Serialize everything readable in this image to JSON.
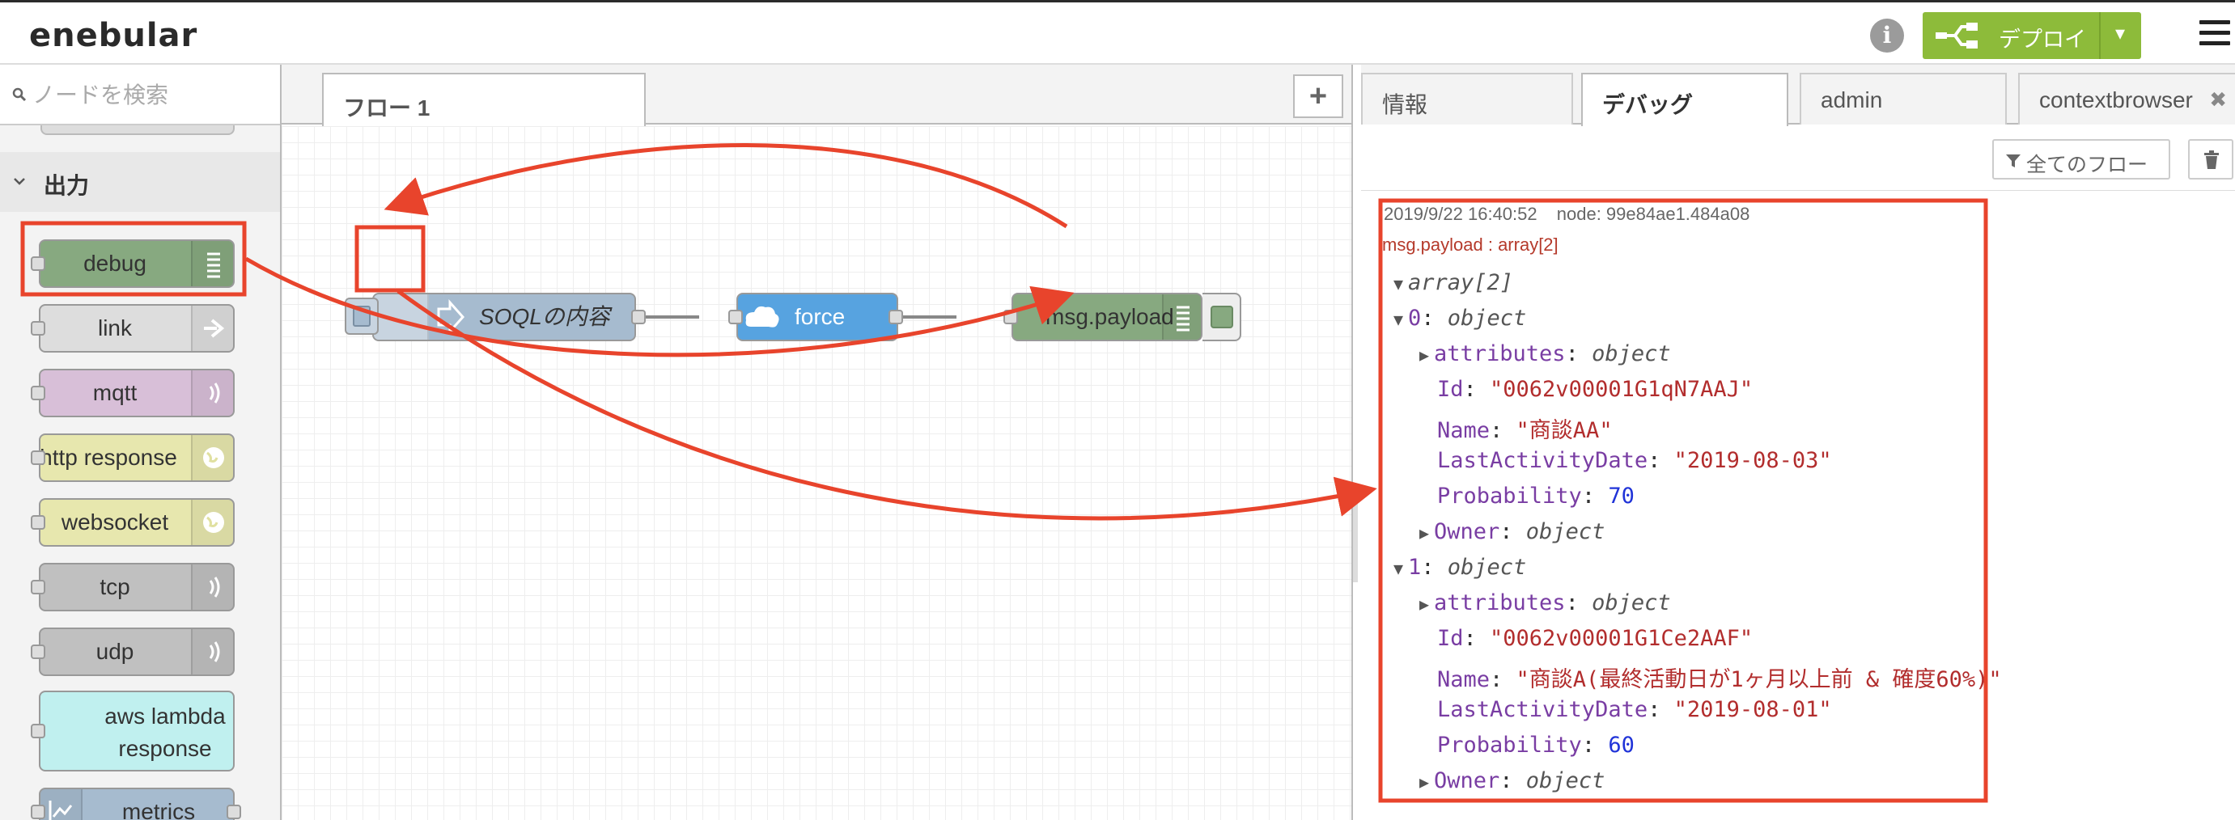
{
  "app": {
    "logo": "enebular"
  },
  "header": {
    "deploy_label": "デプロイ",
    "deploy_caret": "▾"
  },
  "palette": {
    "search_placeholder": "ノードを検索",
    "category": "出力",
    "nodes": [
      {
        "label": "debug",
        "color": "#87a980"
      },
      {
        "label": "link",
        "color": "#dddddd"
      },
      {
        "label": "mqtt",
        "color": "#d8bfd8"
      },
      {
        "label": "http response",
        "color": "#e7e7ae"
      },
      {
        "label": "websocket",
        "color": "#e7e7ae"
      },
      {
        "label": "tcp",
        "color": "#c0c0c0"
      },
      {
        "label": "udp",
        "color": "#c0c0c0"
      },
      {
        "label_line1": "aws lambda",
        "label_line2": "response",
        "color": "#c0f0ef"
      },
      {
        "label": "metrics",
        "color": "#a6bbcf"
      }
    ]
  },
  "workspace": {
    "tab_label": "フロー 1",
    "add_tab": "+",
    "flow_nodes": [
      {
        "label": "SOQLの内容",
        "type": "inject",
        "color": "#a6bbcf"
      },
      {
        "label": "force",
        "type": "salesforce",
        "color": "#57a3e0"
      },
      {
        "label": "msg.payload",
        "type": "debug",
        "color": "#87a980"
      }
    ]
  },
  "sidebar": {
    "tabs": [
      {
        "label": "情報"
      },
      {
        "label": "デバッグ"
      },
      {
        "label": "admin"
      },
      {
        "label": "contextbrowser"
      }
    ],
    "filter_label": "全てのフロー",
    "debug": {
      "timestamp": "2019/9/22 16:40:52",
      "node": "node: 99e84ae1.484a08",
      "topic": "msg.payload : array[2]",
      "tree": {
        "root": "array[2]",
        "item0_key": "0",
        "item1_key": "1",
        "object": "object",
        "attributes_key": "attributes",
        "owner_key": "Owner",
        "id_key": "Id",
        "name_key": "Name",
        "lad_key": "LastActivityDate",
        "prob_key": "Probability",
        "item0": {
          "id": "\"0062v00001G1qN7AAJ\"",
          "name": "\"商談AA\"",
          "lad": "\"2019-08-03\"",
          "prob": "70"
        },
        "item1": {
          "id": "\"0062v00001G1Ce2AAF\"",
          "name": "\"商談A(最終活動日が1ヶ月以上前 & 確度60%)\"",
          "lad": "\"2019-08-01\"",
          "prob": "60"
        }
      }
    }
  },
  "colors": {
    "annotation": "#e8442c",
    "deploy": "#8dbb3a"
  }
}
